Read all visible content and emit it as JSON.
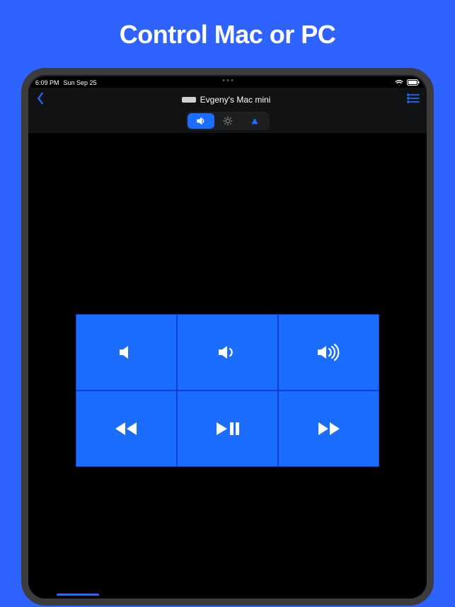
{
  "headline": "Control Mac or PC",
  "status": {
    "time": "6:09 PM",
    "date": "Sun Sep 25"
  },
  "nav": {
    "device_name": "Evgeny's Mac mini"
  },
  "segments": [
    {
      "name": "volume",
      "active": true
    },
    {
      "name": "brightness",
      "active": false
    },
    {
      "name": "media",
      "active": false
    }
  ],
  "controls": [
    {
      "name": "mute"
    },
    {
      "name": "volume-down"
    },
    {
      "name": "volume-up"
    },
    {
      "name": "rewind"
    },
    {
      "name": "play-pause"
    },
    {
      "name": "forward"
    }
  ],
  "colors": {
    "accent": "#1a6dff",
    "page_bg": "#2f63ff"
  }
}
